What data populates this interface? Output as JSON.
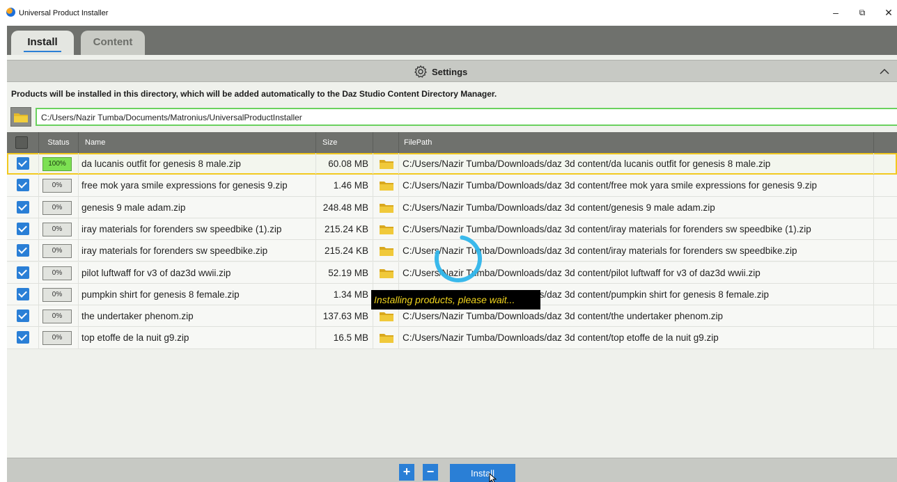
{
  "window": {
    "title": "Universal Product Installer",
    "minimize": "–",
    "maximize": "⧉",
    "close": "✕"
  },
  "tabs": [
    {
      "label": "Install",
      "active": true
    },
    {
      "label": "Content",
      "active": false
    }
  ],
  "settings": {
    "label": "Settings",
    "icon": "gear-icon",
    "collapse_icon": "chevron-up-icon"
  },
  "info_text": "Products will be installed in this directory, which will be added automatically to the Daz Studio Content Directory Manager.",
  "install_dir": "C:/Users/Nazir Tumba/Documents/Matronius/UniversalProductInstaller",
  "table": {
    "headers": {
      "status": "Status",
      "name": "Name",
      "size": "Size",
      "filepath": "FilePath"
    },
    "rows": [
      {
        "checked": true,
        "status": "100%",
        "name": "da lucanis outfit for genesis 8 male.zip",
        "size": "60.08 MB",
        "path": "C:/Users/Nazir Tumba/Downloads/daz 3d content/da lucanis outfit for genesis 8 male.zip"
      },
      {
        "checked": true,
        "status": "0%",
        "name": "free mok yara smile expressions for genesis 9.zip",
        "size": "1.46 MB",
        "path": "C:/Users/Nazir Tumba/Downloads/daz 3d content/free mok yara smile expressions for genesis 9.zip"
      },
      {
        "checked": true,
        "status": "0%",
        "name": "genesis 9 male adam.zip",
        "size": "248.48 MB",
        "path": "C:/Users/Nazir Tumba/Downloads/daz 3d content/genesis 9 male adam.zip"
      },
      {
        "checked": true,
        "status": "0%",
        "name": "iray materials for forenders sw speedbike (1).zip",
        "size": "215.24 KB",
        "path": "C:/Users/Nazir Tumba/Downloads/daz 3d content/iray materials for forenders sw speedbike (1).zip"
      },
      {
        "checked": true,
        "status": "0%",
        "name": "iray materials for forenders sw speedbike.zip",
        "size": "215.24 KB",
        "path": "C:/Users/Nazir Tumba/Downloads/daz 3d content/iray materials for forenders sw speedbike.zip"
      },
      {
        "checked": true,
        "status": "0%",
        "name": "pilot luftwaff for v3 of daz3d wwii.zip",
        "size": "52.19 MB",
        "path": "C:/Users/Nazir Tumba/Downloads/daz 3d content/pilot luftwaff for v3 of daz3d wwii.zip"
      },
      {
        "checked": true,
        "status": "0%",
        "name": "pumpkin shirt for genesis 8 female.zip",
        "size": "1.34 MB",
        "path": "C:/Users/Nazir Tumba/Downloads/daz 3d content/pumpkin shirt for genesis 8 female.zip"
      },
      {
        "checked": true,
        "status": "0%",
        "name": "the undertaker phenom.zip",
        "size": "137.63 MB",
        "path": "C:/Users/Nazir Tumba/Downloads/daz 3d content/the undertaker phenom.zip"
      },
      {
        "checked": true,
        "status": "0%",
        "name": "top etoffe de la nuit g9.zip",
        "size": "16.5 MB",
        "path": "C:/Users/Nazir Tumba/Downloads/daz 3d content/top etoffe de la nuit g9.zip"
      }
    ]
  },
  "overlay": {
    "message": "Installing products, please wait..."
  },
  "bottom": {
    "add": "+",
    "remove": "−",
    "install": "Install"
  },
  "colors": {
    "accent": "#2a7fd6",
    "progress_done": "#7ce052",
    "header_bg": "#6f716d",
    "wait_text": "#f3d61d",
    "selected_outline": "#f2c91f"
  }
}
